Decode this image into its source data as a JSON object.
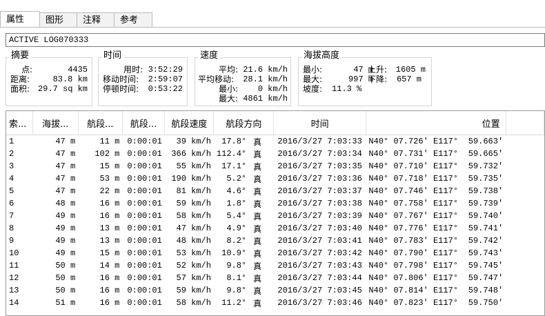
{
  "tabs": [
    {
      "label": "属性"
    },
    {
      "label": "图形"
    },
    {
      "label": "注释"
    },
    {
      "label": "参考"
    }
  ],
  "name_field": {
    "value": "ACTIVE LOG070333"
  },
  "summary": {
    "title": "摘要",
    "points_label": "点:",
    "points_value": "4435",
    "distance_label": "距离:",
    "distance_value": "83.8 km",
    "area_label": "面积:",
    "area_value": "29.7 sq km"
  },
  "time": {
    "title": "时间",
    "elapsed_label": "用时:",
    "elapsed_value": "3:52:29",
    "moving_label": "移动时间:",
    "moving_value": "2:59:07",
    "stopped_label": "停顿时间:",
    "stopped_value": "0:53:22"
  },
  "speed": {
    "title": "速度",
    "avg_label": "平均:",
    "avg_value": "21.6 km/h",
    "avg_moving_label": "平均移动:",
    "avg_moving_value": "28.1 km/h",
    "min_label": "最小:",
    "min_value": "0 km/h",
    "max_label": "最大:",
    "max_value": "4861 km/h"
  },
  "altitude": {
    "title": "海拔高度",
    "min_label": "最小:",
    "min_value": "47 m",
    "ascent_label": "上升:",
    "ascent_value": "1605 m",
    "max_label": "最大:",
    "max_value": "997 m",
    "descent_label": "下降:",
    "descent_value": "657 m",
    "grade_label": "坡度:",
    "grade_value": "11.3 %"
  },
  "table": {
    "headers": [
      "索...",
      "海拔...",
      "航段...",
      "航段...",
      "航段速度",
      "航段方向",
      "时间",
      "位置"
    ],
    "rows": [
      [
        "1",
        "47 m",
        "11 m",
        "0:00:01",
        "39 km/h",
        "17.8°",
        "真",
        "2016/3/27 7:03:33",
        "N40° 07.726′ E117°",
        "59.663′"
      ],
      [
        "2",
        "47 m",
        "102 m",
        "0:00:01",
        "366 km/h",
        "112.4°",
        "真",
        "2016/3/27 7:03:34",
        "N40° 07.731′ E117°",
        "59.665′"
      ],
      [
        "3",
        "47 m",
        "15 m",
        "0:00:01",
        "55 km/h",
        "17.1°",
        "真",
        "2016/3/27 7:03:35",
        "N40° 07.710′ E117°",
        "59.732′"
      ],
      [
        "4",
        "47 m",
        "53 m",
        "0:00:01",
        "190 km/h",
        "5.2°",
        "真",
        "2016/3/27 7:03:36",
        "N40° 07.718′ E117°",
        "59.735′"
      ],
      [
        "5",
        "47 m",
        "22 m",
        "0:00:01",
        "81 km/h",
        "4.6°",
        "真",
        "2016/3/27 7:03:37",
        "N40° 07.746′ E117°",
        "59.738′"
      ],
      [
        "6",
        "48 m",
        "16 m",
        "0:00:01",
        "59 km/h",
        "1.8°",
        "真",
        "2016/3/27 7:03:38",
        "N40° 07.758′ E117°",
        "59.739′"
      ],
      [
        "7",
        "49 m",
        "16 m",
        "0:00:01",
        "58 km/h",
        "5.4°",
        "真",
        "2016/3/27 7:03:39",
        "N40° 07.767′ E117°",
        "59.740′"
      ],
      [
        "8",
        "49 m",
        "13 m",
        "0:00:01",
        "47 km/h",
        "4.9°",
        "真",
        "2016/3/27 7:03:40",
        "N40° 07.776′ E117°",
        "59.741′"
      ],
      [
        "9",
        "49 m",
        "13 m",
        "0:00:01",
        "48 km/h",
        "8.2°",
        "真",
        "2016/3/27 7:03:41",
        "N40° 07.783′ E117°",
        "59.742′"
      ],
      [
        "10",
        "49 m",
        "15 m",
        "0:00:01",
        "53 km/h",
        "10.9°",
        "真",
        "2016/3/27 7:03:42",
        "N40° 07.790′ E117°",
        "59.743′"
      ],
      [
        "11",
        "50 m",
        "14 m",
        "0:00:01",
        "52 km/h",
        "9.8°",
        "真",
        "2016/3/27 7:03:43",
        "N40° 07.798′ E117°",
        "59.745′"
      ],
      [
        "12",
        "50 m",
        "16 m",
        "0:00:01",
        "57 km/h",
        "8.1°",
        "真",
        "2016/3/27 7:03:44",
        "N40° 07.806′ E117°",
        "59.747′"
      ],
      [
        "13",
        "50 m",
        "16 m",
        "0:00:01",
        "59 km/h",
        "9.8°",
        "真",
        "2016/3/27 7:03:45",
        "N40° 07.814′ E117°",
        "59.748′"
      ],
      [
        "14",
        "51 m",
        "16 m",
        "0:00:01",
        "58 km/h",
        "11.2°",
        "真",
        "2016/3/27 7:03:46",
        "N40° 07.823′ E117°",
        "59.750′"
      ]
    ]
  }
}
